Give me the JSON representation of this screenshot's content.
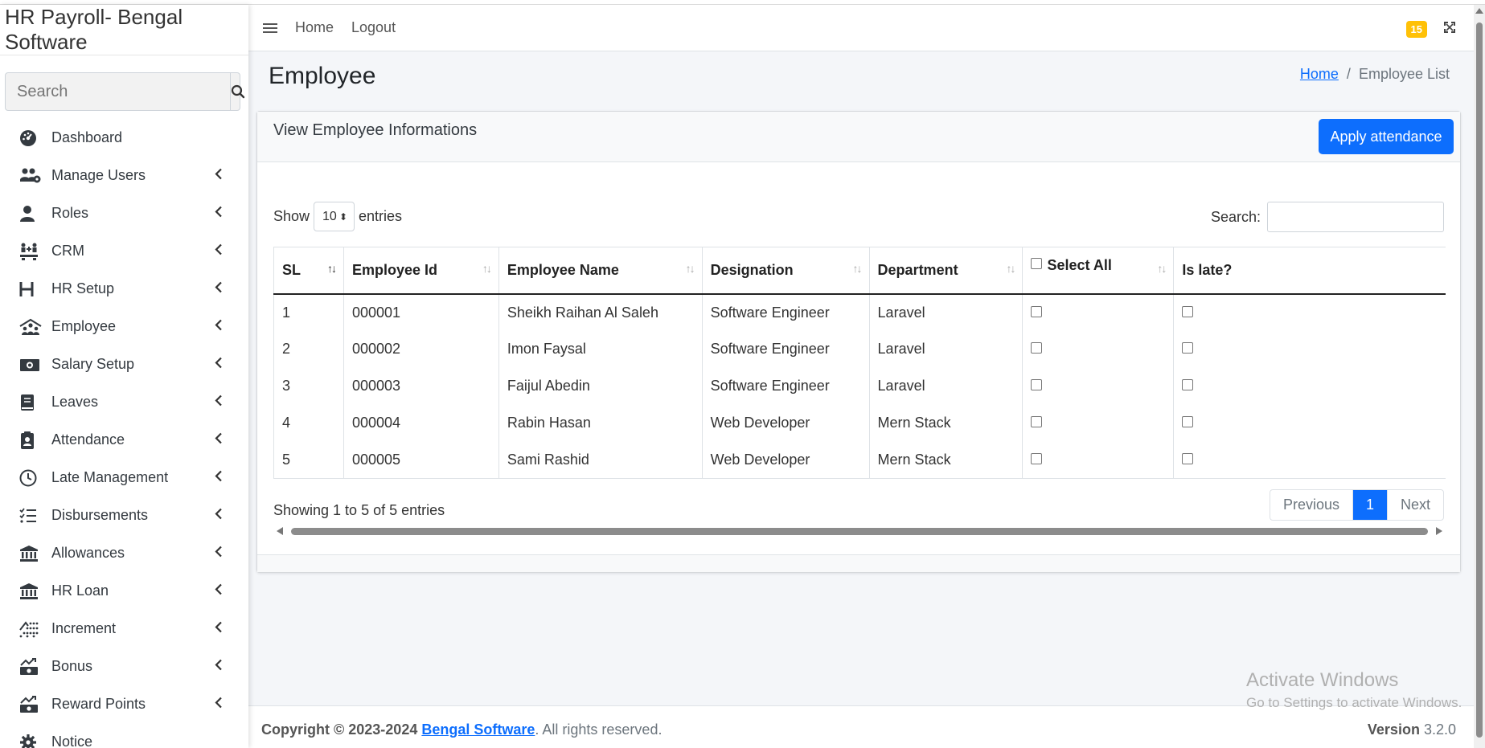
{
  "sidebar": {
    "brand": "HR Payroll- Bengal Software",
    "search_placeholder": "Search",
    "items": [
      {
        "label": "Dashboard",
        "icon": "dashboard-icon",
        "chevron": false
      },
      {
        "label": "Manage Users",
        "icon": "users-icon",
        "chevron": true
      },
      {
        "label": "Roles",
        "icon": "user-icon",
        "chevron": true
      },
      {
        "label": "CRM",
        "icon": "crm-icon",
        "chevron": true
      },
      {
        "label": "HR Setup",
        "icon": "h-icon",
        "chevron": true
      },
      {
        "label": "Employee",
        "icon": "employee-icon",
        "chevron": true
      },
      {
        "label": "Salary Setup",
        "icon": "money-icon",
        "chevron": true
      },
      {
        "label": "Leaves",
        "icon": "book-icon",
        "chevron": true
      },
      {
        "label": "Attendance",
        "icon": "clipboard-icon",
        "chevron": true
      },
      {
        "label": "Late Management",
        "icon": "clock-icon",
        "chevron": true
      },
      {
        "label": "Disbursements",
        "icon": "list-check-icon",
        "chevron": true
      },
      {
        "label": "Allowances",
        "icon": "bank-icon",
        "chevron": true
      },
      {
        "label": "HR Loan",
        "icon": "bank-icon",
        "chevron": true
      },
      {
        "label": "Increment",
        "icon": "increment-icon",
        "chevron": true
      },
      {
        "label": "Bonus",
        "icon": "bonus-icon",
        "chevron": true
      },
      {
        "label": "Reward Points",
        "icon": "reward-icon",
        "chevron": true
      },
      {
        "label": "Notice",
        "icon": "gear-icon",
        "chevron": false
      }
    ]
  },
  "topbar": {
    "home": "Home",
    "logout": "Logout",
    "notification_count": "15"
  },
  "page": {
    "title": "Employee",
    "breadcrumb_home": "Home",
    "breadcrumb_sep": "/",
    "breadcrumb_current": "Employee List"
  },
  "card": {
    "title": "View Employee Informations",
    "apply_button": "Apply attendance"
  },
  "table_controls": {
    "show_label": "Show",
    "entries_value": "10",
    "entries_label": "entries",
    "search_label": "Search:"
  },
  "table": {
    "columns": [
      "SL",
      "Employee Id",
      "Employee Name",
      "Designation",
      "Department",
      "Select All",
      "Is late?"
    ],
    "rows": [
      [
        "1",
        "000001",
        "Sheikh Raihan Al Saleh",
        "Software Engineer",
        "Laravel"
      ],
      [
        "2",
        "000002",
        "Imon Faysal",
        "Software Engineer",
        "Laravel"
      ],
      [
        "3",
        "000003",
        "Faijul Abedin",
        "Software Engineer",
        "Laravel"
      ],
      [
        "4",
        "000004",
        "Rabin Hasan",
        "Web Developer",
        "Mern Stack"
      ],
      [
        "5",
        "000005",
        "Sami Rashid",
        "Web Developer",
        "Mern Stack"
      ]
    ]
  },
  "pagination": {
    "info": "Showing 1 to 5 of 5 entries",
    "previous": "Previous",
    "current": "1",
    "next": "Next"
  },
  "footer": {
    "copyright": "Copyright © 2023-2024",
    "company": "Bengal Software",
    "rights": ". All rights reserved.",
    "version_label": "Version",
    "version": "3.2.0"
  },
  "watermark": {
    "line1": "Activate Windows",
    "line2": "Go to Settings to activate Windows."
  },
  "colors": {
    "primary": "#0d6efd",
    "badge": "#ffc107"
  }
}
